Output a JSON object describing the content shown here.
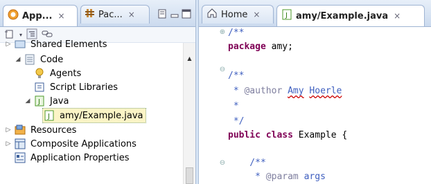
{
  "left_tabs": [
    {
      "label": "App...",
      "close": "×"
    },
    {
      "label": "Pac...",
      "close": "×"
    }
  ],
  "right_tabs": [
    {
      "label": "Home",
      "close": "×"
    },
    {
      "label": "amy/Example.java",
      "close": "×"
    }
  ],
  "tree": {
    "items": [
      {
        "label": "Shared Elements",
        "icon": "shared-elements-icon"
      },
      {
        "label": "Code",
        "icon": "code-icon",
        "expanded": true
      },
      {
        "label": "Agents",
        "icon": "agents-icon"
      },
      {
        "label": "Script Libraries",
        "icon": "script-libraries-icon"
      },
      {
        "label": "Java",
        "icon": "java-folder-icon",
        "expanded": true
      },
      {
        "label": "amy/Example.java",
        "icon": "java-file-icon",
        "selected": true
      },
      {
        "label": "Resources",
        "icon": "resources-icon"
      },
      {
        "label": "Composite Applications",
        "icon": "composite-applications-icon"
      },
      {
        "label": "Application Properties",
        "icon": "application-properties-icon"
      }
    ]
  },
  "editor": {
    "lines": [
      {
        "t": "/**"
      },
      {
        "t": "package amy;"
      },
      {
        "t": ""
      },
      {
        "t": "/**"
      },
      {
        "t": " * @author Amy Hoerle"
      },
      {
        "t": " *"
      },
      {
        "t": " */"
      },
      {
        "t": "public class Example {"
      },
      {
        "t": ""
      },
      {
        "t": "    /**"
      },
      {
        "t": "     * @param args"
      }
    ],
    "parts": {
      "l0": "/**",
      "l1_kw": "package",
      "l1_rest": " amy;",
      "l3": "/**",
      "l4_star": " * ",
      "l4_tag": "@author",
      "l4_sp": " ",
      "l4_name1": "Amy",
      "l4_sp2": " ",
      "l4_name2": "Hoerle",
      "l5": " *",
      "l6": " */",
      "l7_kw1": "public",
      "l7_sp": " ",
      "l7_kw2": "class",
      "l7_rest": " Example {",
      "l9": "    /**",
      "l10_star": "     * ",
      "l10_tag": "@param",
      "l10_rest": " args"
    },
    "colors": {
      "comment": "#3f5fbf",
      "keyword": "#7f0055",
      "javadoc_tag": "#7f7f9f"
    }
  }
}
